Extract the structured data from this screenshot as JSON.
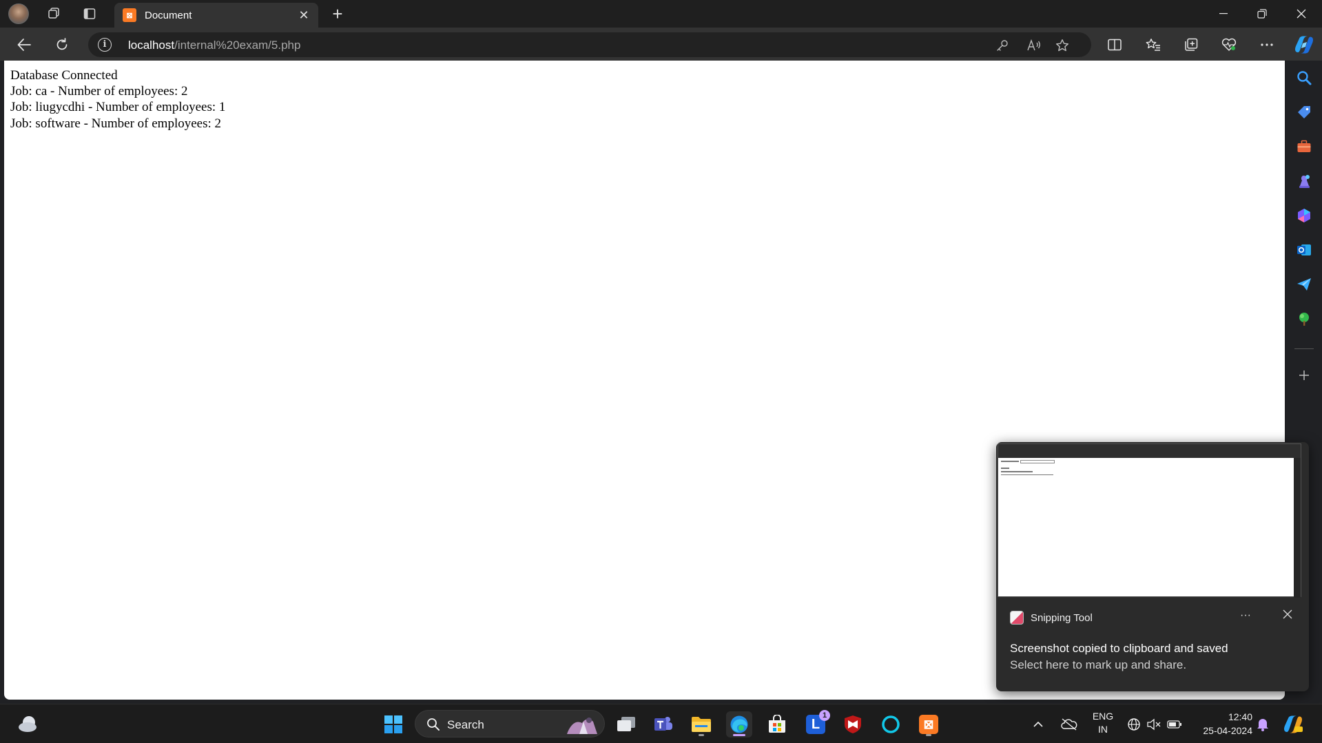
{
  "browser": {
    "tab_title": "Document",
    "tab_favicon": "xampp-icon",
    "url_host": "localhost",
    "url_path": "/internal%20exam/5.php"
  },
  "page": {
    "lines": [
      "Database Connected",
      "Job: ca - Number of employees: 2",
      "Job: liugycdhi - Number of employees: 1",
      "Job: software - Number of employees: 2"
    ]
  },
  "toast": {
    "app_name": "Snipping Tool",
    "more_label": "···",
    "message": "Screenshot copied to clipboard and saved",
    "subtext": "Select here to mark up and share."
  },
  "taskbar": {
    "search_label": "Search",
    "notification_count": "1",
    "language_line1": "ENG",
    "language_line2": "IN",
    "time": "12:40",
    "date": "25-04-2024"
  },
  "colors": {
    "accent": "#c8a2ff",
    "xampp": "#fb7a24",
    "chrome_dark": "#1f1f1f",
    "toolbar": "#333333"
  }
}
